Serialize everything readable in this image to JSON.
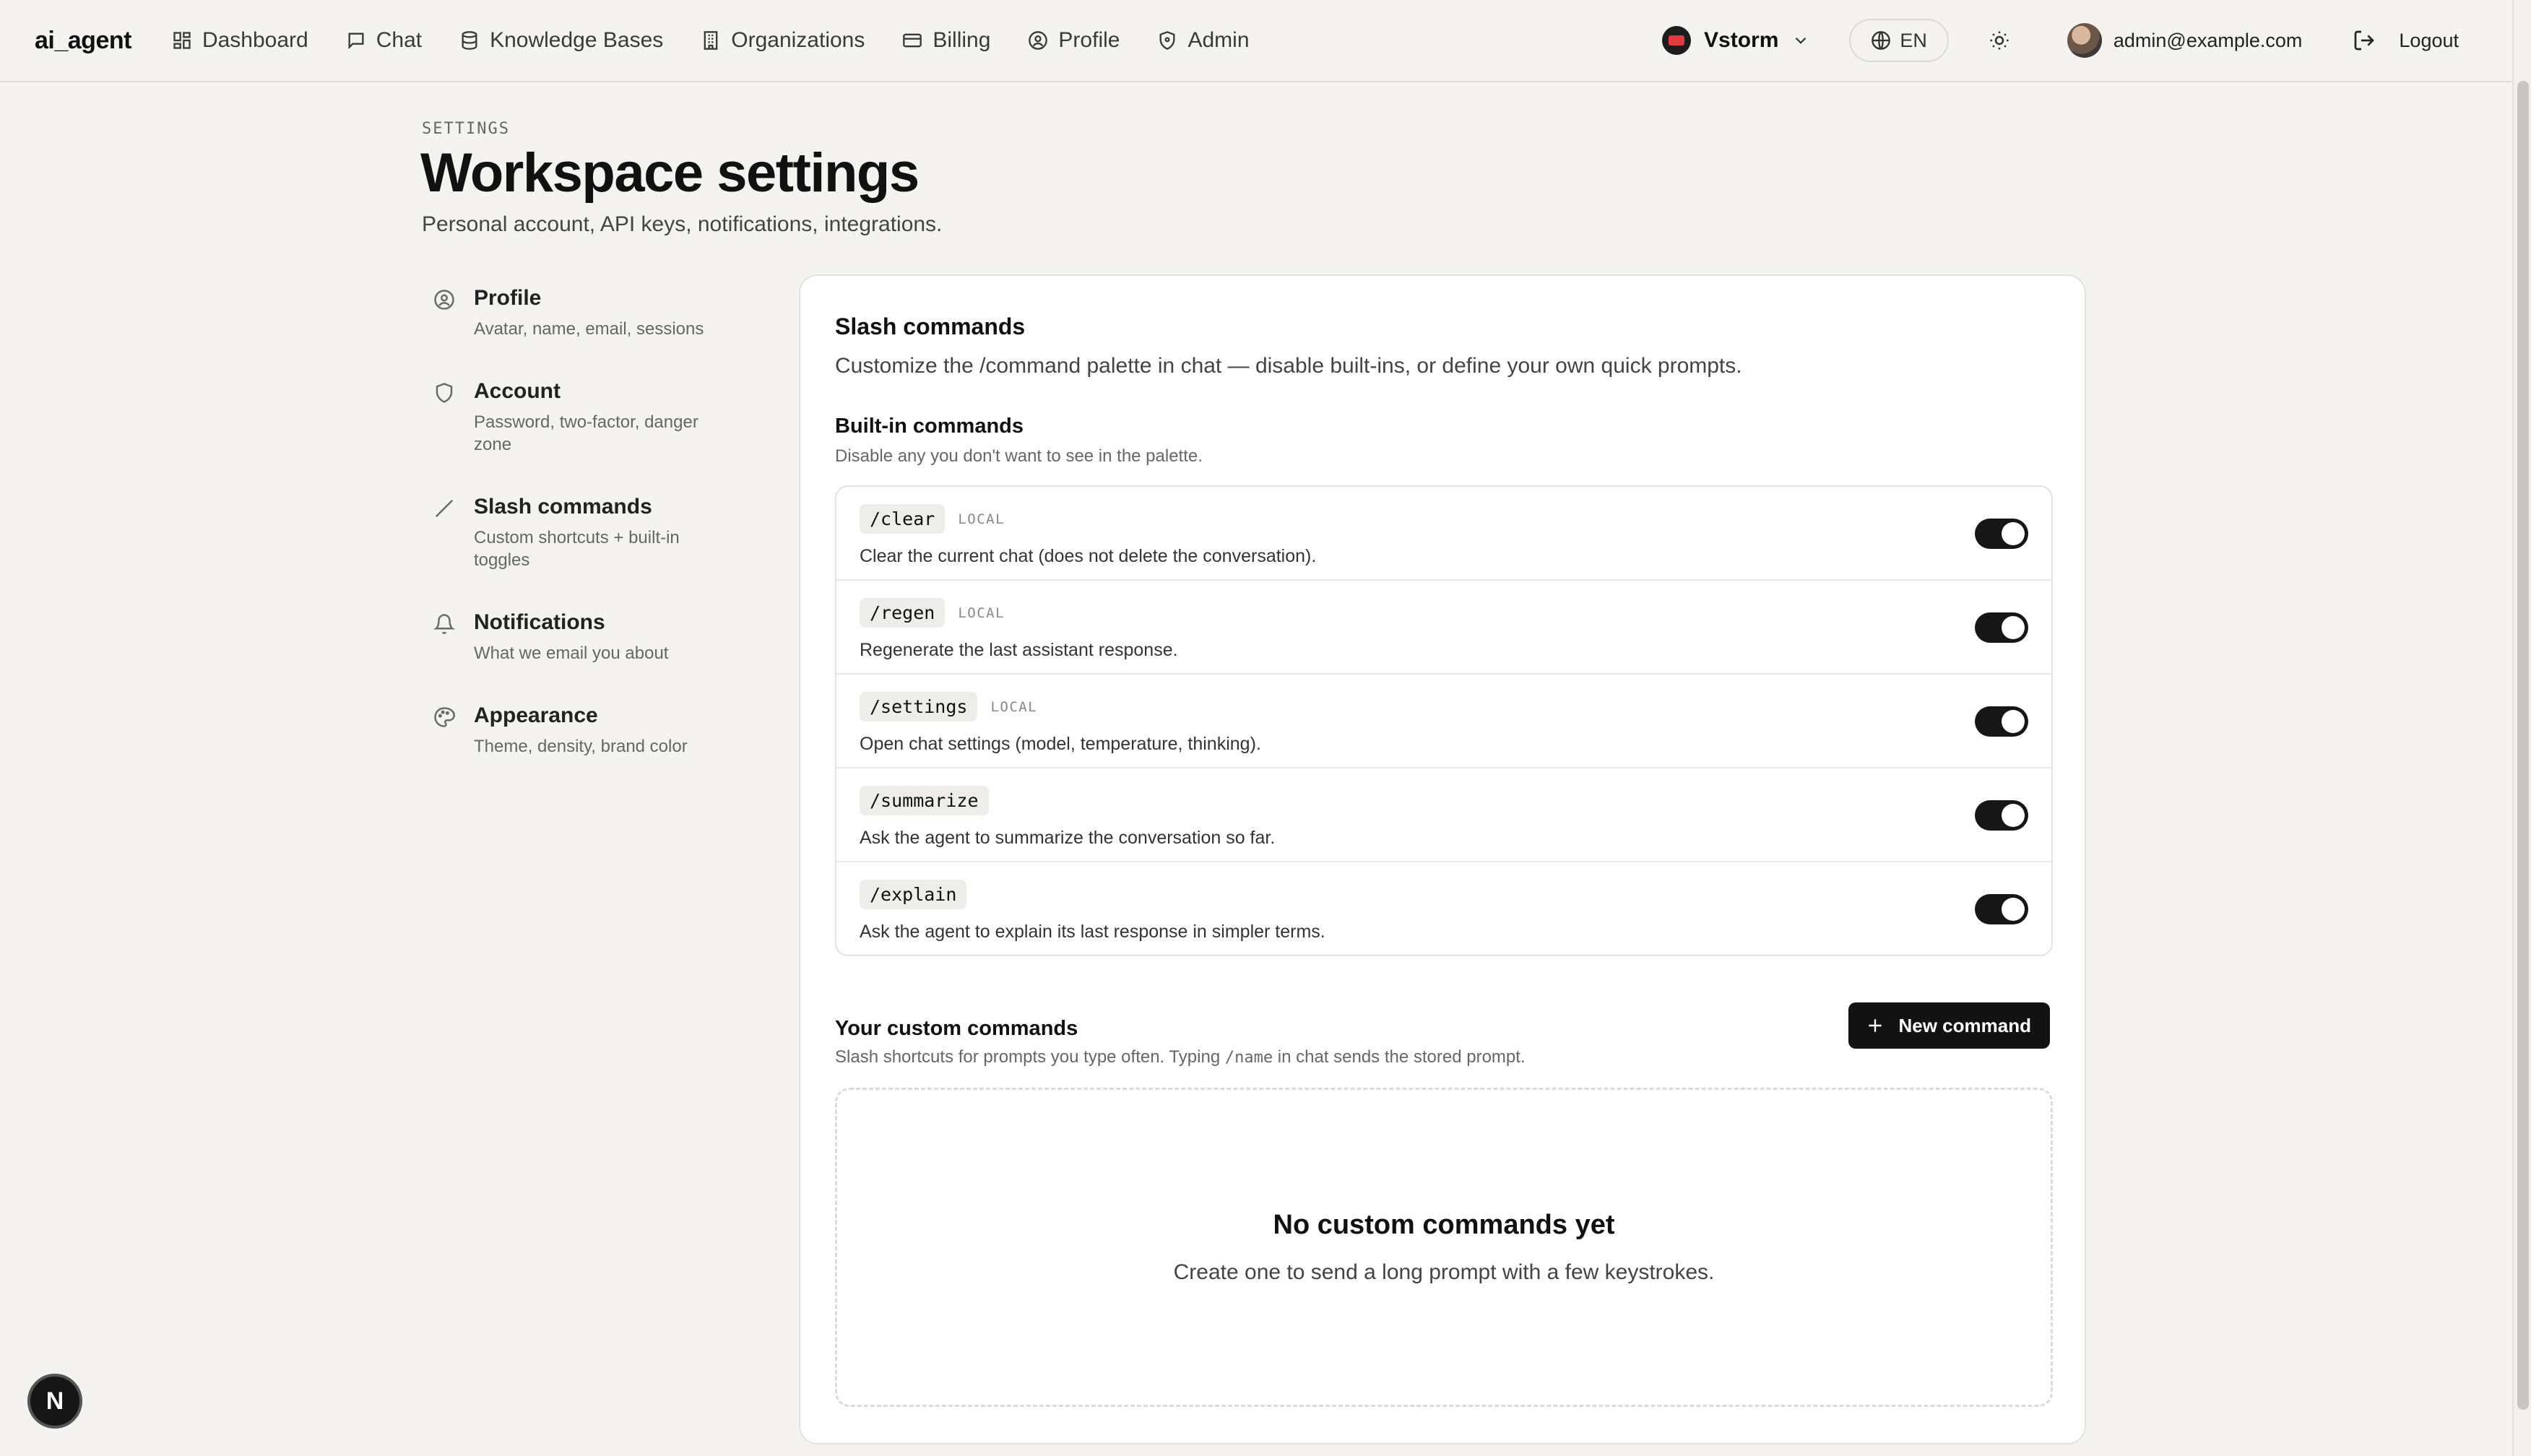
{
  "app": {
    "name": "ai_agent"
  },
  "nav": {
    "items": [
      {
        "label": "Dashboard",
        "icon": "dashboard-icon"
      },
      {
        "label": "Chat",
        "icon": "chat-icon"
      },
      {
        "label": "Knowledge Bases",
        "icon": "database-icon"
      },
      {
        "label": "Organizations",
        "icon": "building-icon"
      },
      {
        "label": "Billing",
        "icon": "card-icon"
      },
      {
        "label": "Profile",
        "icon": "user-circle-icon"
      },
      {
        "label": "Admin",
        "icon": "shield-icon"
      }
    ],
    "org": "Vstorm",
    "language": "EN",
    "user_email": "admin@example.com",
    "logout": "Logout"
  },
  "header": {
    "eyebrow": "SETTINGS",
    "title": "Workspace settings",
    "subtitle": "Personal account, API keys, notifications, integrations."
  },
  "sidebar": {
    "items": [
      {
        "title": "Profile",
        "desc": "Avatar, name, email, sessions",
        "icon": "user-circle-icon"
      },
      {
        "title": "Account",
        "desc": "Password, two-factor, danger zone",
        "icon": "shield-icon"
      },
      {
        "title": "Slash commands",
        "desc": "Custom shortcuts + built-in toggles",
        "icon": "slash-icon"
      },
      {
        "title": "Notifications",
        "desc": "What we email you about",
        "icon": "bell-icon"
      },
      {
        "title": "Appearance",
        "desc": "Theme, density, brand color",
        "icon": "palette-icon"
      }
    ]
  },
  "panel": {
    "title": "Slash commands",
    "subtitle": "Customize the /command palette in chat — disable built-ins, or define your own quick prompts.",
    "builtin": {
      "title": "Built-in commands",
      "subtitle": "Disable any you don't want to see in the palette.",
      "commands": [
        {
          "name": "/clear",
          "tag": "LOCAL",
          "desc": "Clear the current chat (does not delete the conversation).",
          "enabled": true
        },
        {
          "name": "/regen",
          "tag": "LOCAL",
          "desc": "Regenerate the last assistant response.",
          "enabled": true
        },
        {
          "name": "/settings",
          "tag": "LOCAL",
          "desc": "Open chat settings (model, temperature, thinking).",
          "enabled": true
        },
        {
          "name": "/summarize",
          "tag": "",
          "desc": "Ask the agent to summarize the conversation so far.",
          "enabled": true
        },
        {
          "name": "/explain",
          "tag": "",
          "desc": "Ask the agent to explain its last response in simpler terms.",
          "enabled": true
        }
      ]
    },
    "custom": {
      "title": "Your custom commands",
      "subtitle_pre": "Slash shortcuts for prompts you type often. Typing ",
      "subtitle_code": "/name",
      "subtitle_post": " in chat sends the stored prompt.",
      "new_button": "New command",
      "empty_title": "No custom commands yet",
      "empty_sub": "Create one to send a long prompt with a few keystrokes."
    }
  },
  "badge": {
    "letter": "N"
  }
}
